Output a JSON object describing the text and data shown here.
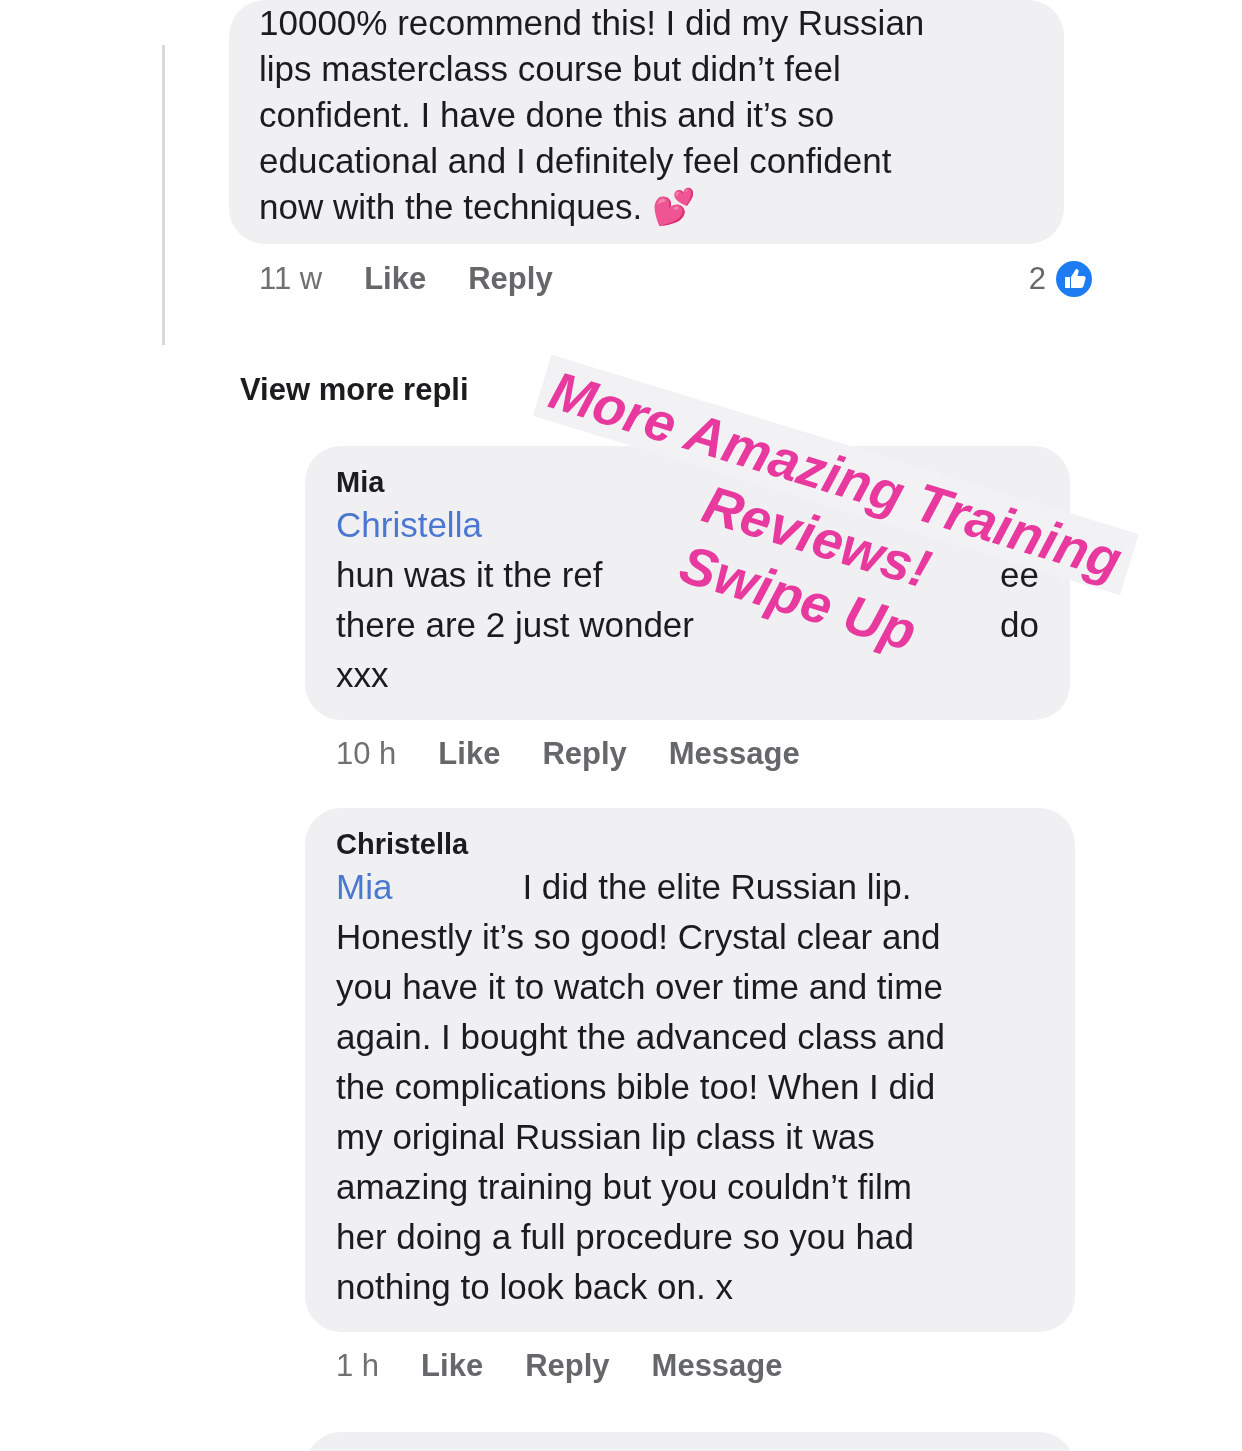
{
  "comments": [
    {
      "kind": "top",
      "lines": [
        "10000% recommend this! I did my Russian",
        "lips masterclass course but didn’t feel",
        "confident. I have done this and it’s so",
        "educational and I definitely feel confident",
        "now with the techniques. 💕"
      ],
      "actions": [
        "11 w",
        "Like",
        "Reply"
      ],
      "reactions": "2"
    },
    {
      "kind": "more",
      "label": "View more repli"
    },
    {
      "kind": "reply_covered",
      "author": "Mia",
      "mention": "Christella",
      "rows": [
        [
          "hun was it the ref",
          "ee"
        ],
        [
          "there are 2 just wonder",
          "do"
        ],
        [
          "xxx"
        ]
      ],
      "actions": [
        "10 h",
        "Like",
        "Reply",
        "Message"
      ]
    },
    {
      "kind": "reply",
      "author": "Christella",
      "mention": "Mia",
      "first": "I did the elite Russian lip.",
      "lines": [
        "Honestly it’s so good! Crystal clear and",
        "you have it to watch over time and time",
        "again. I bought the advanced class and",
        "the complications bible too! When I did",
        "my original Russian lip class it was",
        "amazing training but you couldn’t film",
        "her doing a full procedure so you had",
        "nothing to look back on. x"
      ],
      "actions": [
        "1 h",
        "Like",
        "Reply",
        "Message"
      ]
    }
  ],
  "sticker": {
    "lines": [
      "More Amazing Training",
      "Reviews!",
      "Swipe Up"
    ]
  }
}
